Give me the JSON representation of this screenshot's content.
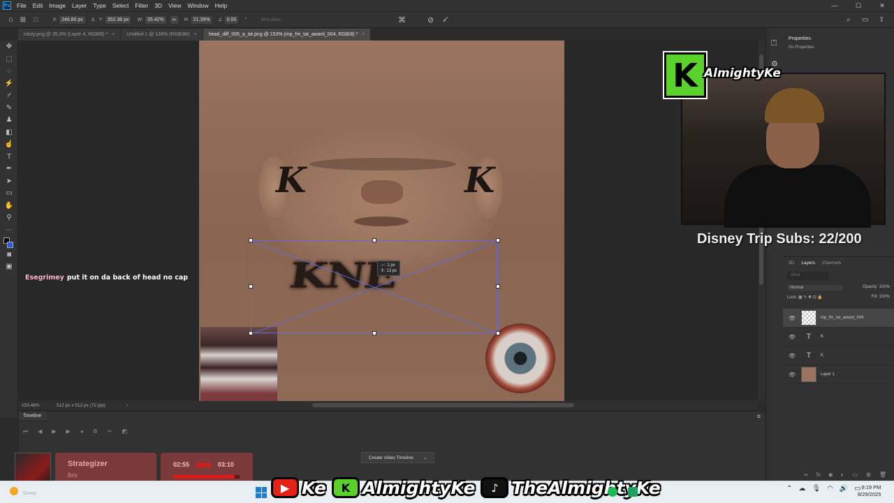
{
  "menu": {
    "app_icon": "Ps",
    "items": [
      "File",
      "Edit",
      "Image",
      "Layer",
      "Type",
      "Select",
      "Filter",
      "3D",
      "View",
      "Window",
      "Help"
    ]
  },
  "options": {
    "x_label": "X:",
    "x_value": "246.80 px",
    "y_label": "Y:",
    "y_value": "352.36 px",
    "w_label": "W:",
    "w_value": "35.42%",
    "h_label": "H:",
    "h_value": "21.39%",
    "angle_value": "0.00",
    "antialias": "Anti-alias"
  },
  "tabs": [
    {
      "label": "nasty.png @ 35.3% (Layer 4, RGB/8) *",
      "close": "×"
    },
    {
      "label": "Untitled-1 @ 134% (RGB/8#)",
      "close": "×"
    },
    {
      "label": "head_diff_005_a_lat.png @ 153% (mp_fm_tat_award_004, RGB/8) *",
      "close": "×"
    }
  ],
  "canvas": {
    "ear_tattoo_left": "K",
    "ear_tattoo_right": "K",
    "neck_tattoo": "KNE",
    "transform_tip_line1": "⇔: 1 px",
    "transform_tip_line2": "⇕: 13 px"
  },
  "status": {
    "zoom": "153.48%",
    "doc_size": "512 px x 512 px (72 ppi)"
  },
  "timeline": {
    "title": "Timeline",
    "create_button": "Create Video Timeline"
  },
  "properties": {
    "title": "Properties",
    "body": "No Properties"
  },
  "layers_panel": {
    "tabs": [
      "3D",
      "Layers",
      "Channels"
    ],
    "search_placeholder": "Kind",
    "blend_mode": "Normal",
    "opacity_label": "Opacity:",
    "opacity": "100%",
    "lock_label": "Lock:",
    "fill_label": "Fill:",
    "fill": "100%",
    "layers": [
      {
        "name": "mp_fm_tat_award_004",
        "type": "image"
      },
      {
        "name": "K",
        "type": "text"
      },
      {
        "name": "K",
        "type": "text"
      },
      {
        "name": "Layer 1",
        "type": "image"
      }
    ]
  },
  "stream": {
    "logo_letter": "K",
    "channel_name": "AlmightyKe",
    "subs_goal": "Disney Trip Subs: 22/200",
    "chat_user": "Esegrimey",
    "chat_message": "put it on da back of head no cap"
  },
  "music": {
    "song_title": "Strategizer",
    "artist": "Bris",
    "elapsed": "02:55",
    "total": "03:10",
    "progress": 0.92
  },
  "taskbar": {
    "weather": "Sunny",
    "social_1": "Ke",
    "social_2": "AlmightyKe",
    "social_3": "TheAlmightyKe",
    "time": "9:19 PM",
    "date": "8/29/2025"
  },
  "colors": {
    "accent_green": "#5bd22c",
    "transform_box": "#5b6ee0",
    "music_bg": "#7a3a3a"
  }
}
